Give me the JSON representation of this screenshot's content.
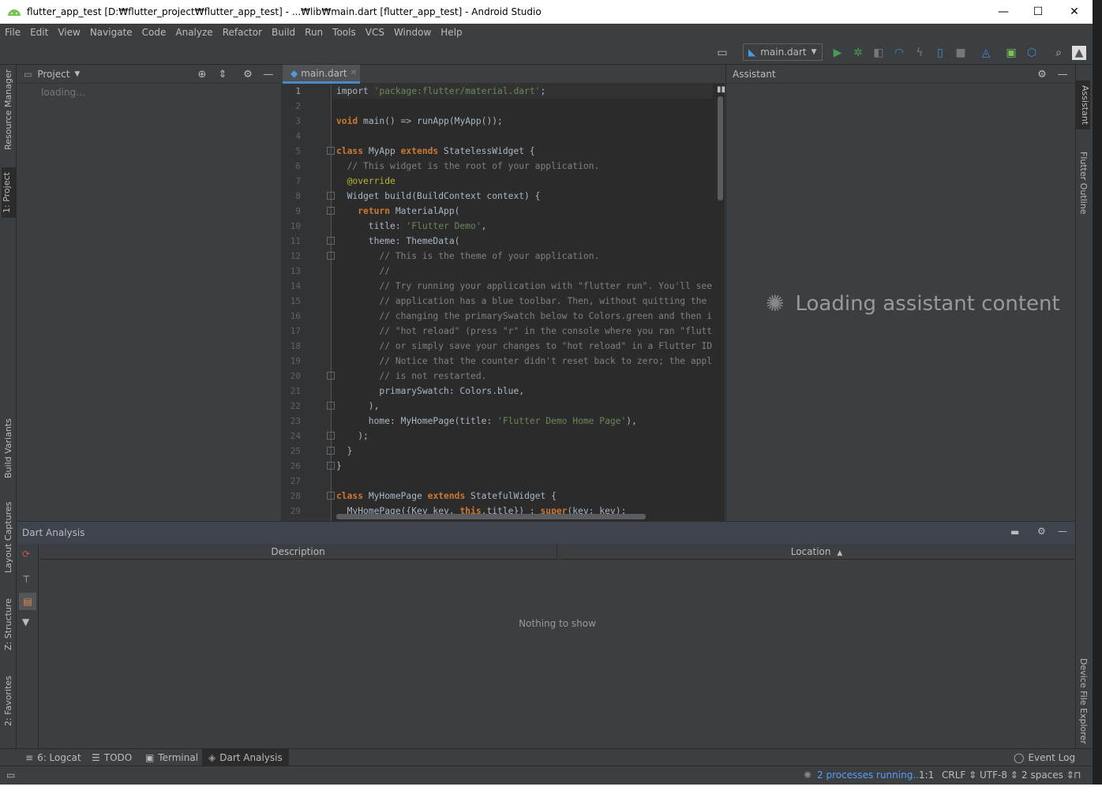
{
  "window": {
    "title": "flutter_app_test [D:₩flutter_project₩flutter_app_test] - ...₩lib₩main.dart [flutter_app_test] - Android Studio",
    "minimize": "—",
    "maximize": "☐",
    "close": "✕"
  },
  "menu": [
    "File",
    "Edit",
    "View",
    "Navigate",
    "Code",
    "Analyze",
    "Refactor",
    "Build",
    "Run",
    "Tools",
    "VCS",
    "Window",
    "Help"
  ],
  "toolbar": {
    "run_config": "main.dart"
  },
  "left_strip": [
    "Resource Manager",
    "1: Project",
    "Build Variants",
    "Layout Captures",
    "Z: Structure",
    "2: Favorites"
  ],
  "right_strip": [
    "Assistant",
    "Flutter Outline",
    "Device File Explorer"
  ],
  "project_panel": {
    "title": "Project",
    "loading": "loading..."
  },
  "editor": {
    "tab": "main.dart",
    "line_numbers": [
      "1",
      "2",
      "3",
      "4",
      "5",
      "6",
      "7",
      "8",
      "9",
      "10",
      "11",
      "12",
      "13",
      "14",
      "15",
      "16",
      "17",
      "18",
      "19",
      "20",
      "21",
      "22",
      "23",
      "24",
      "25",
      "26",
      "27",
      "28",
      "29"
    ]
  },
  "assistant": {
    "title": "Assistant",
    "loading": "Loading assistant content"
  },
  "dart_analysis": {
    "title": "Dart Analysis",
    "col_description": "Description",
    "col_location": "Location",
    "empty": "Nothing to show"
  },
  "bottom_tabs": {
    "logcat": "6: Logcat",
    "todo": "TODO",
    "terminal": "Terminal",
    "dart_analysis": "Dart Analysis",
    "event_log": "Event Log"
  },
  "status": {
    "processes": "2 processes running...",
    "position": "1:1",
    "line_sep": "CRLF",
    "encoding": "UTF-8",
    "indent": "2 spaces"
  },
  "colors": {
    "accent": "#4a88c7",
    "run_green": "#499c54",
    "keyword": "#cc7832",
    "string": "#6a8759",
    "comment": "#808080"
  }
}
